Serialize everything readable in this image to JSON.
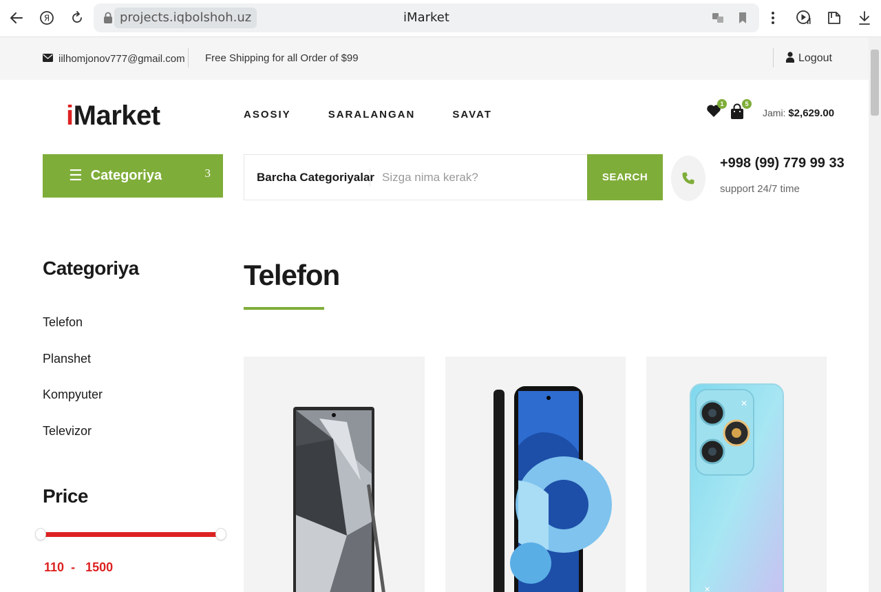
{
  "browser": {
    "url": "projects.iqbolshoh.uz",
    "tab_title": "iMarket"
  },
  "topbar": {
    "email": "iilhomjonov777@gmail.com",
    "shipping": "Free Shipping for all Order of $99",
    "logout": "Logout"
  },
  "header": {
    "logo_i": "i",
    "logo_rest": "Market",
    "nav": [
      "ASOSIY",
      "SARALANGAN",
      "SAVAT"
    ],
    "wishlist_count": "1",
    "cart_count": "5",
    "total_label": "Jami:",
    "total_value": "$2,629.00"
  },
  "category_button": {
    "label": "Categoriya",
    "count": "3"
  },
  "search": {
    "category": "Barcha Categoriyalar",
    "placeholder": "Sizga nima kerak?",
    "button": "SEARCH"
  },
  "contact": {
    "phone": "+998 (99) 779 99 33",
    "support": "support 24/7 time"
  },
  "sidebar": {
    "title": "Categoriya",
    "items": [
      "Telefon",
      "Planshet",
      "Kompyuter",
      "Televizor"
    ],
    "price_title": "Price",
    "price_min": "110",
    "price_sep": "-",
    "price_max": "1500"
  },
  "main": {
    "section_title": "Telefon"
  },
  "colors": {
    "accent_green": "#7fad39",
    "accent_red": "#dd2222"
  },
  "products": [
    {
      "image": "samsung-galaxy-s24-ultra-phone-image"
    },
    {
      "image": "blue-android-phone-image"
    },
    {
      "image": "cyan-smartphone-back-image"
    }
  ]
}
